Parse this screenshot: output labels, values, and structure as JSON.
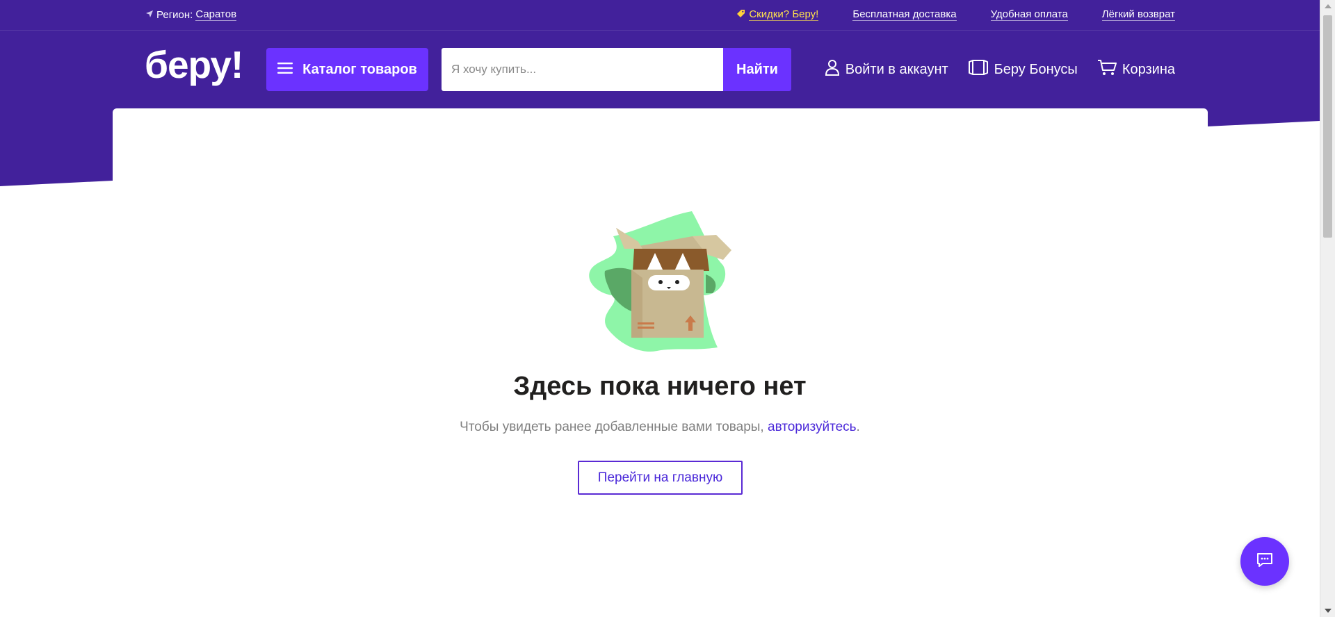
{
  "topbar": {
    "region_label": "Регион:",
    "region_value": "Саратов",
    "sale_label": "Скидки? Беру!",
    "delivery_label": "Бесплатная доставка",
    "payment_label": "Удобная оплата",
    "return_label": "Лёгкий возврат"
  },
  "header": {
    "logo": "беру!",
    "catalog_label": "Каталог товаров",
    "search_placeholder": "Я хочу купить...",
    "search_button": "Найти",
    "login_label": "Войти в аккаунт",
    "bonus_label": "Беру Бонусы",
    "cart_label": "Корзина"
  },
  "main": {
    "title": "Здесь пока ничего нет",
    "subtitle_prefix": "Чтобы увидеть ранее добавленные вами товары,",
    "subtitle_link": "авторизуйтесь",
    "subtitle_suffix": ".",
    "home_button": "Перейти на главную"
  },
  "colors": {
    "brand_purple": "#42219b",
    "accent_purple": "#6b32ff",
    "link": "#4a28d9",
    "sale_yellow": "#ffe14d"
  },
  "icons": {
    "region": "location-arrow-icon",
    "sale": "tag-icon",
    "catalog": "hamburger-icon",
    "login": "user-icon",
    "bonus": "bonus-card-icon",
    "cart": "cart-icon",
    "chat": "chat-icon"
  }
}
